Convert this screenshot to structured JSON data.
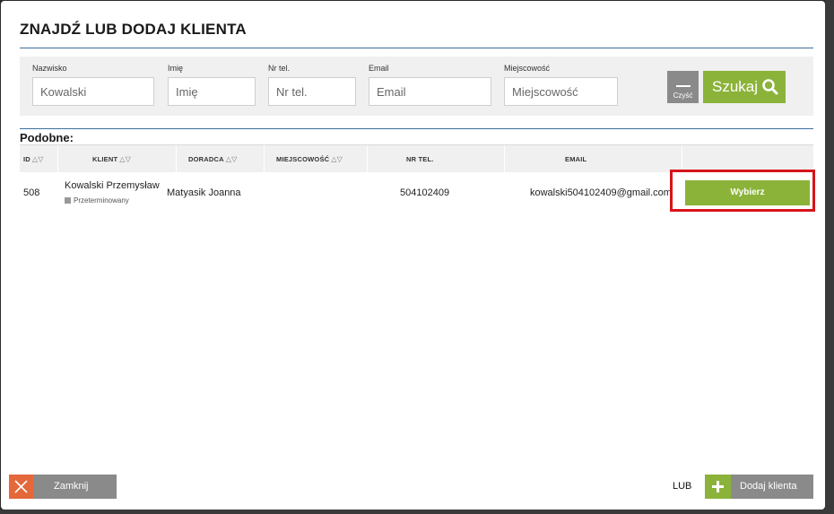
{
  "header": {
    "title": "ZNAJDŹ LUB DODAJ KLIENTA"
  },
  "search": {
    "fields": [
      {
        "label": "Nazwisko",
        "value": "",
        "placeholder": "Kowalski"
      },
      {
        "label": "Imię",
        "value": "",
        "placeholder": "Imię"
      },
      {
        "label": "Nr tel.",
        "value": "",
        "placeholder": "Nr tel."
      },
      {
        "label": "Email",
        "value": "",
        "placeholder": "Email"
      },
      {
        "label": "Miejscowość",
        "value": "",
        "placeholder": "Miejscowość"
      }
    ],
    "clear_label": "Czyść",
    "search_label": "Szukaj"
  },
  "results": {
    "title": "Podobne:",
    "columns": [
      "ID",
      "KLIENT",
      "DORADCA",
      "MIEJSCOWOŚĆ",
      "NR TEL.",
      "EMAIL"
    ],
    "rows": [
      {
        "id": "508",
        "client": "Kowalski Przemysław",
        "status": "Przeterminowany",
        "advisor": "Matyasik Joanna",
        "city": "",
        "phone": "504102409",
        "email": "kowalski504102409@gmail.com",
        "action": "Wybierz"
      }
    ]
  },
  "footer": {
    "close_label": "Zamknij",
    "or_label": "LUB",
    "add_label": "Dodaj klienta"
  },
  "colors": {
    "accent_green": "#8bb33a",
    "close_orange": "#e4683a",
    "rule_blue": "#3e6f9e",
    "highlight_red": "#d7141a"
  }
}
